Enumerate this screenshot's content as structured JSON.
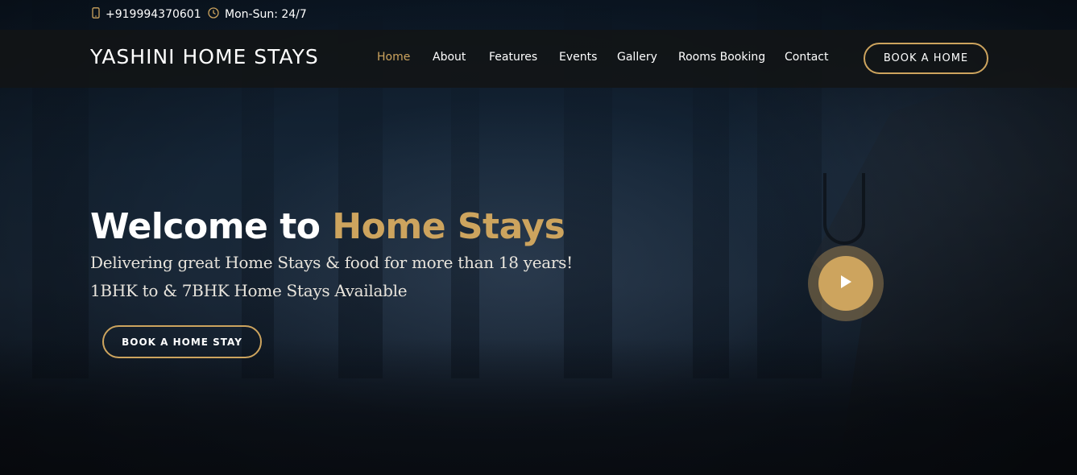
{
  "topbar": {
    "phone": "+919994370601",
    "hours": "Mon-Sun: 24/7"
  },
  "header": {
    "logo": "YASHINI HOME STAYS",
    "nav": [
      {
        "label": "Home",
        "active": true
      },
      {
        "label": "About",
        "active": false
      },
      {
        "label": "Features",
        "active": false
      },
      {
        "label": "Events",
        "active": false
      },
      {
        "label": "Gallery",
        "active": false
      },
      {
        "label": "Rooms Booking",
        "active": false
      },
      {
        "label": "Contact",
        "active": false
      }
    ],
    "cta": "BOOK A HOME"
  },
  "hero": {
    "title_plain": "Welcome to ",
    "title_accent": "Home Stays",
    "line1": "Delivering great Home Stays & food for more than 18 years!",
    "line2": "1BHK to & 7BHK Home Stays Available",
    "cta": "BOOK A HOME STAY"
  },
  "colors": {
    "accent": "#cda45e",
    "header_bg": "#121416",
    "text": "#ffffff"
  },
  "icons": {
    "phone": "mobile-phone-icon",
    "hours": "clock-icon",
    "play": "play-icon"
  }
}
